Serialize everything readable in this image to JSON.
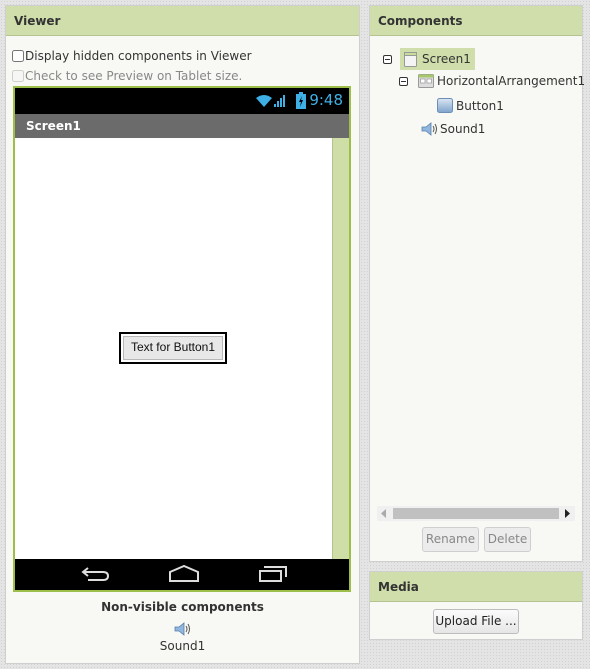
{
  "viewer": {
    "title": "Viewer",
    "display_hidden_label": "Display hidden components in Viewer",
    "display_hidden_checked": false,
    "tablet_preview_label": "Check to see Preview on Tablet size.",
    "tablet_preview_checked": false,
    "phone": {
      "status_time": "9:48",
      "screen_title": "Screen1",
      "button_text": "Text for Button1"
    },
    "nonvisible_title": "Non-visible components",
    "nonvisible_items": [
      {
        "name": "Sound1",
        "icon": "speaker-icon"
      }
    ]
  },
  "components": {
    "title": "Components",
    "tree": [
      {
        "label": "Screen1",
        "icon": "screen-icon",
        "level": 0,
        "expanded": true,
        "selected": true
      },
      {
        "label": "HorizontalArrangement1",
        "icon": "horizontal-arrangement-icon",
        "level": 1,
        "expanded": true,
        "selected": false
      },
      {
        "label": "Button1",
        "icon": "button-icon",
        "level": 2,
        "selected": false
      },
      {
        "label": "Sound1",
        "icon": "speaker-icon",
        "level": 1,
        "selected": false
      }
    ],
    "rename_label": "Rename",
    "delete_label": "Delete"
  },
  "media": {
    "title": "Media",
    "upload_label": "Upload File ..."
  },
  "colors": {
    "panel_header": "#cfdeab",
    "phone_border": "#9dbf4a",
    "status_text": "#3fb0e6"
  }
}
